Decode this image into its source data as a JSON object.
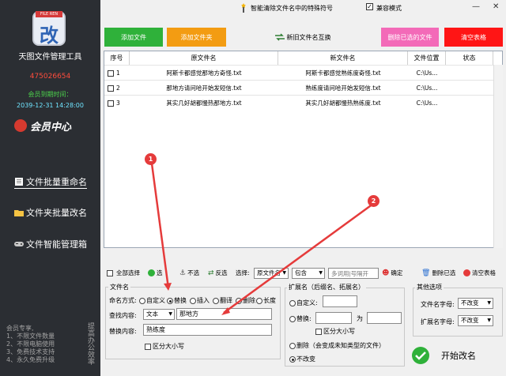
{
  "sidebar": {
    "logo_badge": "FILE REN",
    "logo_glyph": "改",
    "app_title": "天图文件管理工具",
    "qq": "475026654",
    "expiry_label": "会员到期时间：",
    "expiry_date": "2039-12-31 14:28:00",
    "member_center": "会员中心",
    "nav": [
      {
        "label": "文件批量重命名",
        "icon": "document-icon"
      },
      {
        "label": "文件夹批量改名",
        "icon": "folder-icon"
      },
      {
        "label": "文件智能管理箱",
        "icon": "gamepad-icon"
      }
    ],
    "promo_lines": [
      "会员专享,",
      "1、不限文件数量",
      "2、不限电脑使用",
      "3、免费技术支持",
      "4、永久免费升级"
    ],
    "promo_side": "提高办公效率"
  },
  "topbar": {
    "title": "智能清除文件名中的特殊符号",
    "compat_label": "兼容模式",
    "compat_checked": "✓",
    "minimize": "—",
    "close": "✕"
  },
  "toolbar": {
    "add_file": "添加文件",
    "add_folder": "添加文件夹",
    "swap": "新旧文件名互换",
    "delete_selected": "删除已选的文件",
    "clear_table": "清空表格"
  },
  "grid": {
    "headers": [
      "序号",
      "原文件名",
      "新文件名",
      "文件位置",
      "状态"
    ],
    "rows": [
      {
        "num": "1",
        "old": "阿斯卡都感觉那地方奇怪.txt",
        "new": "阿斯卡都感觉熟练度奇怪.txt",
        "loc": "C:\\Us...",
        "status": ""
      },
      {
        "num": "2",
        "old": "那地方请问哈开始发短信.txt",
        "new": "熟练度请问哈开始发短信.txt",
        "loc": "C:\\Us...",
        "status": ""
      },
      {
        "num": "3",
        "old": "其实几好胡都慢热那地方.txt",
        "new": "其实几好胡都慢热熟练度.txt",
        "loc": "C:\\Us...",
        "status": ""
      }
    ]
  },
  "selection_bar": {
    "select_all": "全部选择",
    "select": "选",
    "unselect": "不选",
    "invert": "反选",
    "select_label": "选择:",
    "field_value": "原文件名",
    "match_value": "包含",
    "keyword_placeholder": "多词用|号隔开",
    "confirm": "确定",
    "delete_selected": "删除已选",
    "clear_table": "清空表格"
  },
  "filename_group": {
    "title": "文件名",
    "mode_label": "命名方式:",
    "modes": [
      "自定义",
      "替换",
      "插入",
      "翻译",
      "删除",
      "长度"
    ],
    "selected_mode": "替换",
    "find_label": "查找内容:",
    "find_type": "文本",
    "find_value": "那地方",
    "replace_label": "替换内容:",
    "replace_value": "熟练度",
    "case_label": "区分大小写"
  },
  "extension_group": {
    "title": "扩展名（后缀名、拓展名）",
    "custom_label": "自定义:",
    "replace_label": "替换:",
    "wei": "为",
    "case_label": "区分大小写",
    "delete_label": "删除（会变成未知类型的文件）",
    "nochange_label": "不改变"
  },
  "other_group": {
    "title": "其他选项",
    "filename_font_label": "文件名字母:",
    "filename_font_value": "不改变",
    "ext_font_label": "扩展名字母:",
    "ext_font_value": "不改变"
  },
  "start_button": "开始改名",
  "annotations": [
    "1",
    "2"
  ],
  "colors": {
    "sidebar_bg": "#2b2e33",
    "add_file": "#2fb13a",
    "add_folder": "#f39c12",
    "delete_selected": "#f36ab8",
    "clear_table": "#ff1515",
    "qq": "#ff4c3c",
    "arrow": "#e53b3b"
  }
}
